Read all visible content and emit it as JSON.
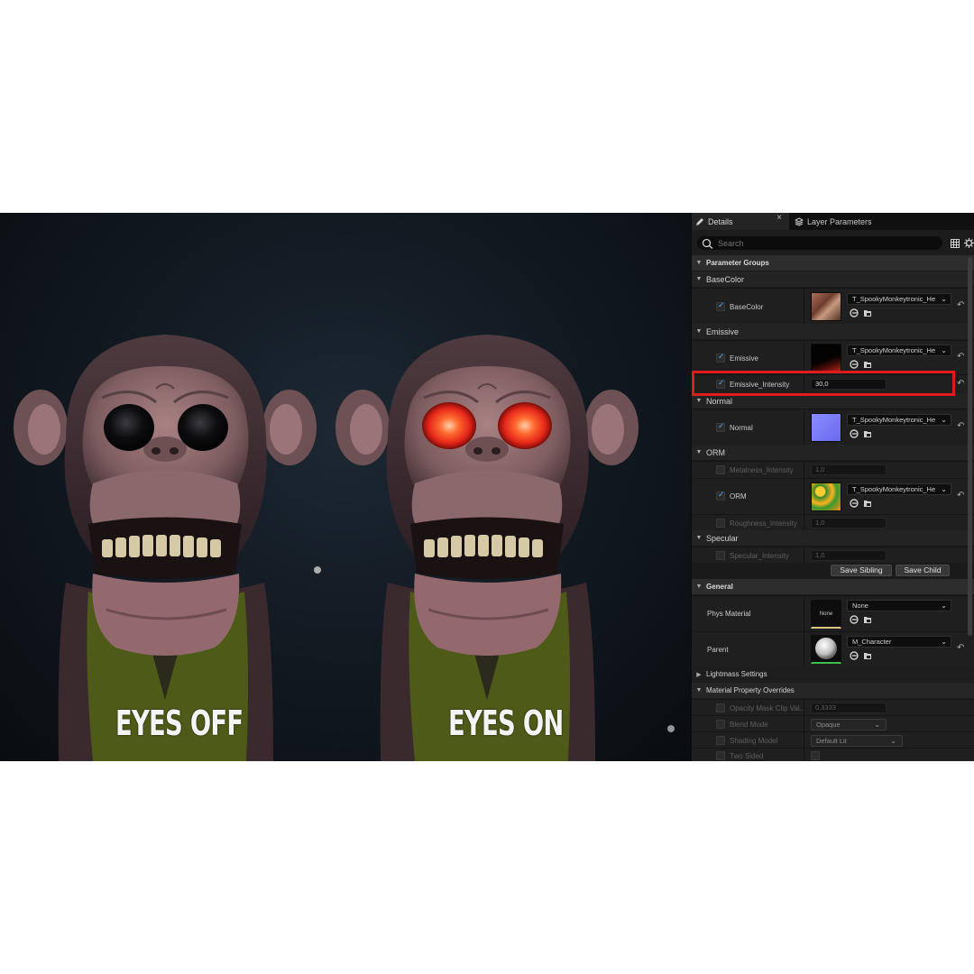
{
  "viewport": {
    "caption_left": "EYES OFF",
    "caption_right": "EYES ON"
  },
  "tabs": {
    "details": "Details",
    "details_close": "×",
    "layer_parameters": "Layer Parameters"
  },
  "search": {
    "placeholder": "Search"
  },
  "sections": {
    "parameter_groups": "Parameter Groups",
    "basecolor": "BaseColor",
    "emissive": "Emissive",
    "normal": "Normal",
    "orm": "ORM",
    "specular": "Specular",
    "general": "General",
    "lightmass": "Lightmass Settings",
    "overrides": "Material Property Overrides"
  },
  "params": {
    "basecolor": {
      "label": "BaseColor",
      "texture": "T_SpookyMonkeytronic_He",
      "enabled": true
    },
    "emissive": {
      "label": "Emissive",
      "texture": "T_SpookyMonkeytronic_He",
      "enabled": true
    },
    "emissive_intensity": {
      "label": "Emissive_Intensity",
      "value": "30,0",
      "enabled": true
    },
    "normal": {
      "label": "Normal",
      "texture": "T_SpookyMonkeytronic_He",
      "enabled": true
    },
    "metalness_intensity": {
      "label": "Metalness_Intensity",
      "value": "1,0",
      "enabled": false
    },
    "orm": {
      "label": "ORM",
      "texture": "T_SpookyMonkeytronic_He",
      "enabled": true
    },
    "roughness_intensity": {
      "label": "Roughness_Intensity",
      "value": "1,0",
      "enabled": false
    },
    "specular_intensity": {
      "label": "Specular_Intensity",
      "value": "1,0",
      "enabled": false
    }
  },
  "buttons": {
    "save_sibling": "Save Sibling",
    "save_child": "Save Child"
  },
  "general": {
    "phys_material": {
      "label": "Phys Material",
      "thumb_text": "None",
      "value": "None"
    },
    "parent": {
      "label": "Parent",
      "value": "M_Character"
    }
  },
  "overrides": {
    "opacity_mask": {
      "label": "Opacity Mask Clip Val..",
      "value": "0,3333"
    },
    "blend_mode": {
      "label": "Blend Mode",
      "value": "Opaque"
    },
    "shading_model": {
      "label": "Shading Model",
      "value": "Default Lit"
    },
    "two_sided": {
      "label": "Two Sided"
    }
  },
  "colors": {
    "highlight": "#e01b1b",
    "checkbox_accent": "#4aa3ff",
    "panel_bg": "#1a1a1a"
  }
}
